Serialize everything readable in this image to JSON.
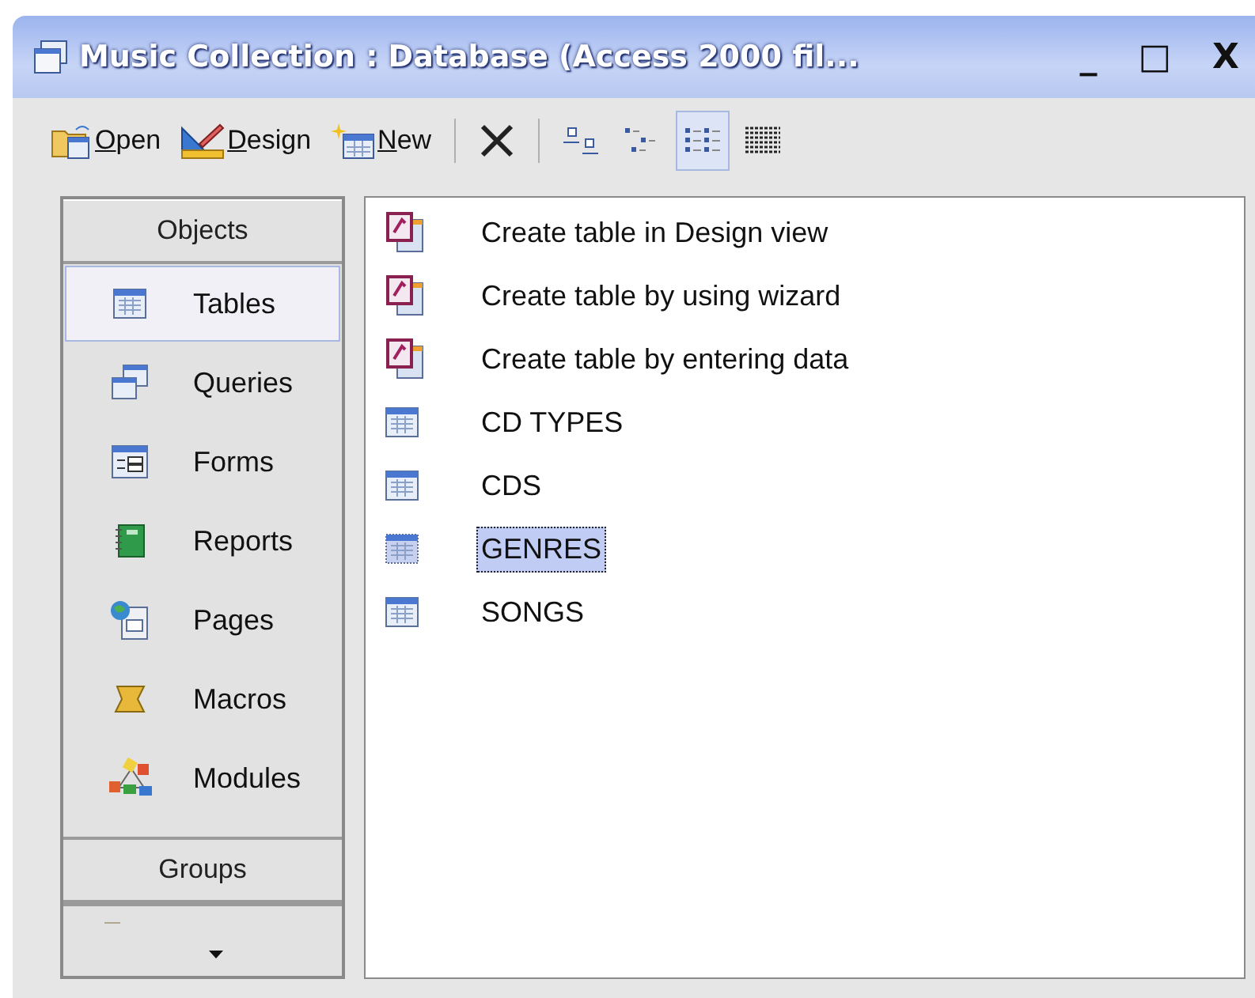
{
  "window": {
    "title": "Music Collection : Database (Access 2000 fil...",
    "controls": [
      "_",
      "□",
      "X"
    ]
  },
  "toolbar": [
    {
      "kind": "open",
      "label": "Open"
    },
    {
      "kind": "design",
      "label": "Design"
    },
    {
      "kind": "new",
      "label": "New"
    },
    {
      "kind": "separator"
    },
    {
      "kind": "delete"
    },
    {
      "kind": "separator"
    },
    {
      "kind": "large-icons",
      "selected": false
    },
    {
      "kind": "small-icons",
      "selected": false
    },
    {
      "kind": "list",
      "selected": true
    },
    {
      "kind": "details",
      "selected": false
    }
  ],
  "sidebar": {
    "header": "Objects",
    "items": [
      {
        "kind": "tables",
        "label": "Tables",
        "selected": true
      },
      {
        "kind": "queries",
        "label": "Queries",
        "selected": false
      },
      {
        "kind": "forms",
        "label": "Forms",
        "selected": false
      },
      {
        "kind": "reports",
        "label": "Reports",
        "selected": false
      },
      {
        "kind": "pages",
        "label": "Pages",
        "selected": false
      },
      {
        "kind": "macros",
        "label": "Macros",
        "selected": false
      },
      {
        "kind": "modules",
        "label": "Modules",
        "selected": false
      }
    ],
    "groups_header": "Groups"
  },
  "objects": [
    {
      "kind": "wizard",
      "label": "Create table in Design view",
      "selected": false
    },
    {
      "kind": "wizard",
      "label": "Create table by using wizard",
      "selected": false
    },
    {
      "kind": "wizard",
      "label": "Create table by entering data",
      "selected": false
    },
    {
      "kind": "table",
      "label": "CD TYPES",
      "selected": false
    },
    {
      "kind": "table",
      "label": "CDS",
      "selected": false
    },
    {
      "kind": "table",
      "label": "GENRES",
      "selected": true
    },
    {
      "kind": "table",
      "label": "SONGS",
      "selected": false
    }
  ]
}
